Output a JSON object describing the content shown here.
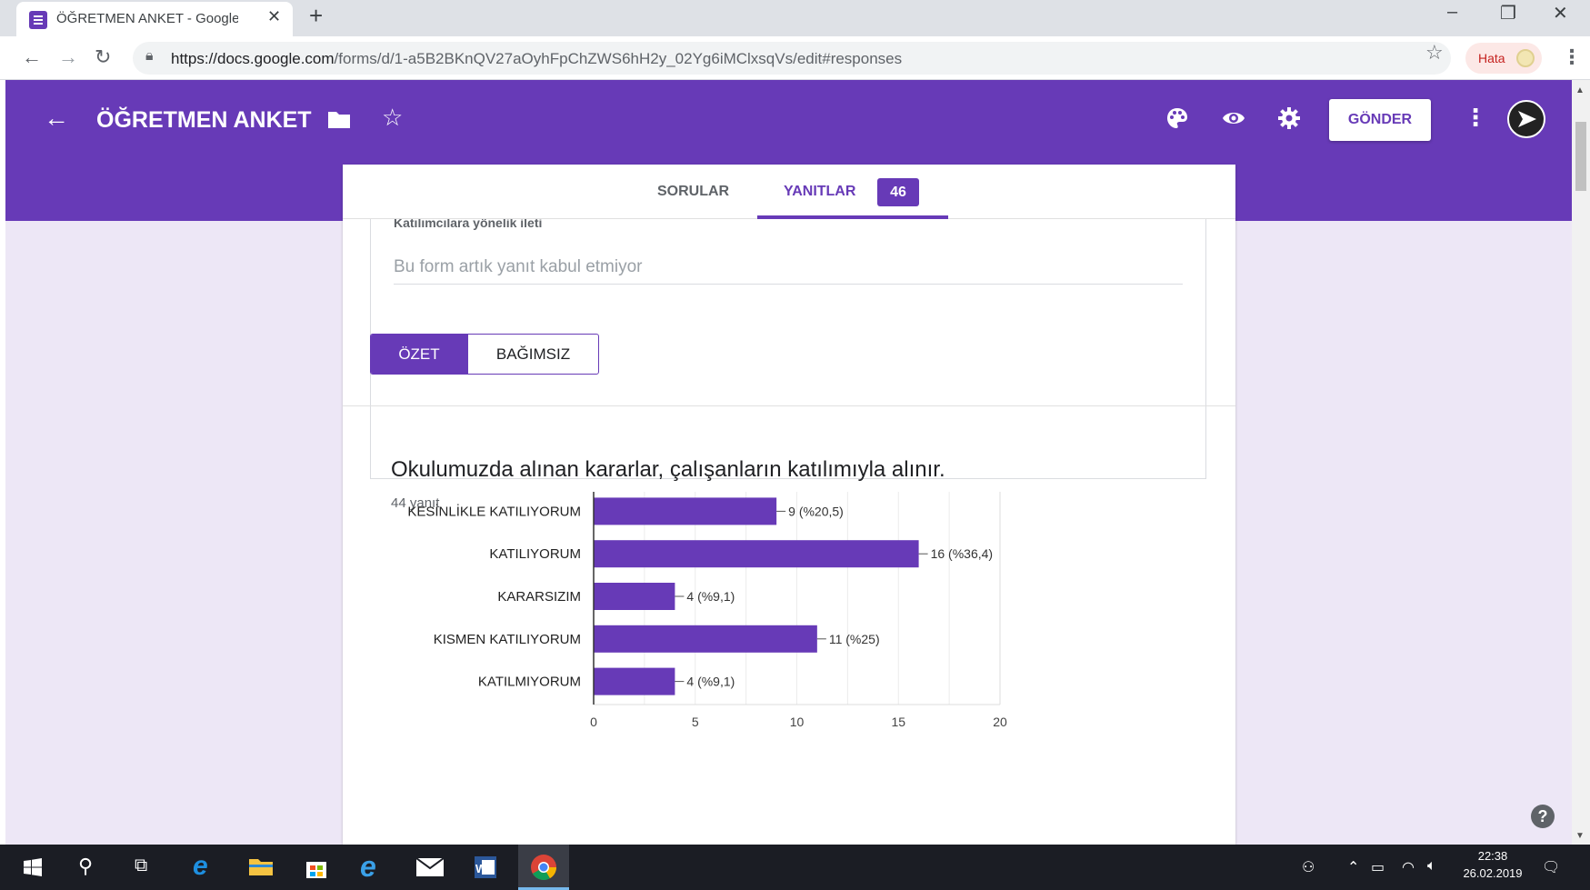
{
  "browser": {
    "tab_title": "ÖĞRETMEN ANKET - Google For",
    "url_host": "https://docs.google.com",
    "url_path": "/forms/d/1-a5B2BKnQV27aOyhFpChZWS6hH2y_02Yg6iMClxsqVs/edit#responses",
    "error_chip": "Hata"
  },
  "form": {
    "title": "ÖĞRETMEN ANKET",
    "send_label": "GÖNDER",
    "accent_color": "#673ab7"
  },
  "tabs": {
    "questions_label": "SORULAR",
    "responses_label": "YANITLAR",
    "responses_count": "46"
  },
  "message": {
    "label": "Katılımcılara yönelik ileti",
    "value": "Bu form artık yanıt kabul etmiyor"
  },
  "view_toggle": {
    "summary_label": "ÖZET",
    "individual_label": "BAĞIMSIZ"
  },
  "question": {
    "title": "Okulumuzda alınan kararlar, çalışanların katılımıyla alınır.",
    "response_count": "44 yanıt"
  },
  "chart_data": {
    "type": "bar",
    "orientation": "horizontal",
    "categories": [
      "KESİNLİKLE KATILIYORUM",
      "KATILIYORUM",
      "KARARSIZIM",
      "KISMEN KATILIYORUM",
      "KATILMIYORUM"
    ],
    "values": [
      9,
      16,
      4,
      11,
      4
    ],
    "data_labels": [
      "9 (%20,5)",
      "16 (%36,4)",
      "4 (%9,1)",
      "11 (%25)",
      "4 (%9,1)"
    ],
    "xlim": [
      0,
      20
    ],
    "x_ticks": [
      0,
      5,
      10,
      15,
      20
    ],
    "bar_color": "#673ab7",
    "grid": true
  },
  "taskbar": {
    "time": "22:38",
    "date": "26.02.2019"
  }
}
